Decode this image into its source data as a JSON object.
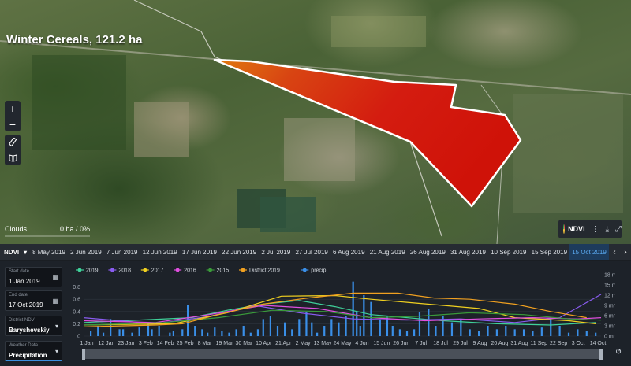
{
  "map": {
    "title": "Winter Cereals, 121.2 ha",
    "zoom_in": "+",
    "zoom_out": "−",
    "clouds_label": "Clouds",
    "clouds_value": "0 ha / 0%",
    "layer_pill": "NDVI",
    "icons": [
      "ruler-icon",
      "book-icon",
      "info-icon",
      "download-icon",
      "fullscreen-icon"
    ]
  },
  "datestrip": {
    "layer": "NDVI",
    "dates": [
      "8 May 2019",
      "2 Jun 2019",
      "7 Jun 2019",
      "12 Jun 2019",
      "17 Jun 2019",
      "22 Jun 2019",
      "2 Jul 2019",
      "27 Jul 2019",
      "6 Aug 2019",
      "21 Aug 2019",
      "26 Aug 2019",
      "31 Aug 2019",
      "10 Sep 2019",
      "15 Sep 2019",
      "15 Oct 2019"
    ],
    "active_index": 14
  },
  "controls": {
    "start_label": "Start date",
    "start_value": "1 Jan 2019",
    "end_label": "End date",
    "end_value": "17 Oct 2019",
    "district_label": "District NDVI",
    "district_value": "Baryshevskiy",
    "weather_label": "Weather Data",
    "weather_value": "Precipitation"
  },
  "colors": {
    "2019": "#3fd19a",
    "2018": "#8a5cf0",
    "2017": "#f0d020",
    "2016": "#e04fe0",
    "2015": "#3a9a3a",
    "District 2019": "#f0a020",
    "precip": "#3a8fe8",
    "accent": "#3a8fe0",
    "field_fill": "#d41c10"
  },
  "chart_data": {
    "type": "line",
    "x_ticks": [
      "1 Jan",
      "12 Jan",
      "23 Jan",
      "3 Feb",
      "14 Feb",
      "25 Feb",
      "8 Mar",
      "19 Mar",
      "30 Mar",
      "10 Apr",
      "21 Apr",
      "2 May",
      "13 May",
      "24 May",
      "4 Jun",
      "15 Jun",
      "26 Jun",
      "7 Jul",
      "18 Jul",
      "29 Jul",
      "9 Aug",
      "20 Aug",
      "31 Aug",
      "11 Sep",
      "22 Sep",
      "3 Oct",
      "14 Oct"
    ],
    "y_left_ticks": [
      "0",
      "0.2",
      "0.4",
      "0.6",
      "0.8"
    ],
    "y_right_ticks": [
      "0 mm",
      "3 mm",
      "6 mm",
      "9 mm",
      "12 mm",
      "15 mm",
      "18 mm"
    ],
    "ylim_left": [
      0,
      1
    ],
    "ylim_right": [
      0,
      18
    ],
    "x_range_days": [
      0,
      288
    ],
    "legend": [
      "2019",
      "2018",
      "2017",
      "2016",
      "2015",
      "District 2019",
      "precip"
    ],
    "series": [
      {
        "name": "2019",
        "x": [
          0,
          60,
          80,
          100,
          120,
          140,
          160,
          200,
          230,
          260,
          285
        ],
        "y": [
          0.22,
          0.3,
          0.42,
          0.52,
          0.58,
          0.48,
          0.35,
          0.25,
          0.2,
          0.18,
          0.22
        ]
      },
      {
        "name": "2018",
        "x": [
          0,
          40,
          70,
          95,
          120,
          150,
          180,
          210,
          240,
          265,
          288
        ],
        "y": [
          0.3,
          0.2,
          0.32,
          0.5,
          0.38,
          0.28,
          0.26,
          0.28,
          0.22,
          0.3,
          0.68
        ]
      },
      {
        "name": "2017",
        "x": [
          0,
          50,
          80,
          110,
          140,
          160,
          180,
          200,
          220,
          240,
          270,
          285
        ],
        "y": [
          0.18,
          0.2,
          0.38,
          0.65,
          0.66,
          0.6,
          0.55,
          0.5,
          0.45,
          0.3,
          0.25,
          0.2
        ]
      },
      {
        "name": "2016",
        "x": [
          0,
          40,
          70,
          100,
          130,
          160,
          190,
          220,
          250,
          275,
          288
        ],
        "y": [
          0.25,
          0.22,
          0.35,
          0.5,
          0.45,
          0.3,
          0.25,
          0.28,
          0.3,
          0.28,
          0.3
        ]
      },
      {
        "name": "2015",
        "x": [
          0,
          45,
          75,
          105,
          135,
          160,
          185,
          215,
          245,
          270,
          288
        ],
        "y": [
          0.18,
          0.22,
          0.3,
          0.42,
          0.4,
          0.3,
          0.32,
          0.38,
          0.35,
          0.28,
          0.26
        ]
      },
      {
        "name": "District 2019",
        "x": [
          0,
          40,
          55,
          75,
          100,
          125,
          150,
          175,
          195,
          215,
          240,
          260,
          280
        ],
        "y": [
          0.15,
          0.18,
          0.2,
          0.35,
          0.52,
          0.62,
          0.7,
          0.7,
          0.62,
          0.6,
          0.52,
          0.4,
          0.3
        ]
      }
    ],
    "precip": {
      "days": [
        4,
        8,
        11,
        15,
        20,
        22,
        27,
        31,
        36,
        38,
        42,
        48,
        50,
        55,
        58,
        62,
        66,
        69,
        73,
        77,
        81,
        85,
        89,
        93,
        97,
        100,
        104,
        108,
        112,
        116,
        120,
        124,
        127,
        130,
        134,
        138,
        142,
        146,
        150,
        152,
        154,
        156,
        160,
        165,
        169,
        172,
        176,
        180,
        184,
        187,
        192,
        196,
        200,
        205,
        210,
        215,
        220,
        225,
        230,
        235,
        240,
        245,
        250,
        255,
        260,
        265,
        270,
        275,
        280,
        285
      ],
      "mm": [
        1.5,
        3,
        1,
        5,
        2,
        2,
        1,
        2.5,
        4,
        2,
        3,
        1,
        1.5,
        2,
        9,
        3,
        2,
        1,
        2.5,
        1.5,
        1,
        2,
        3,
        1,
        2,
        5,
        6,
        3,
        4,
        2,
        5,
        7,
        4,
        1,
        3,
        5,
        4,
        6,
        16,
        7,
        3,
        12,
        10,
        5,
        6,
        3,
        2,
        1.5,
        2,
        7,
        8,
        3,
        6,
        4,
        5,
        2,
        1.5,
        3,
        2,
        3,
        2,
        2,
        1.5,
        2.5,
        5,
        3,
        1,
        2,
        1.5,
        1
      ]
    }
  }
}
